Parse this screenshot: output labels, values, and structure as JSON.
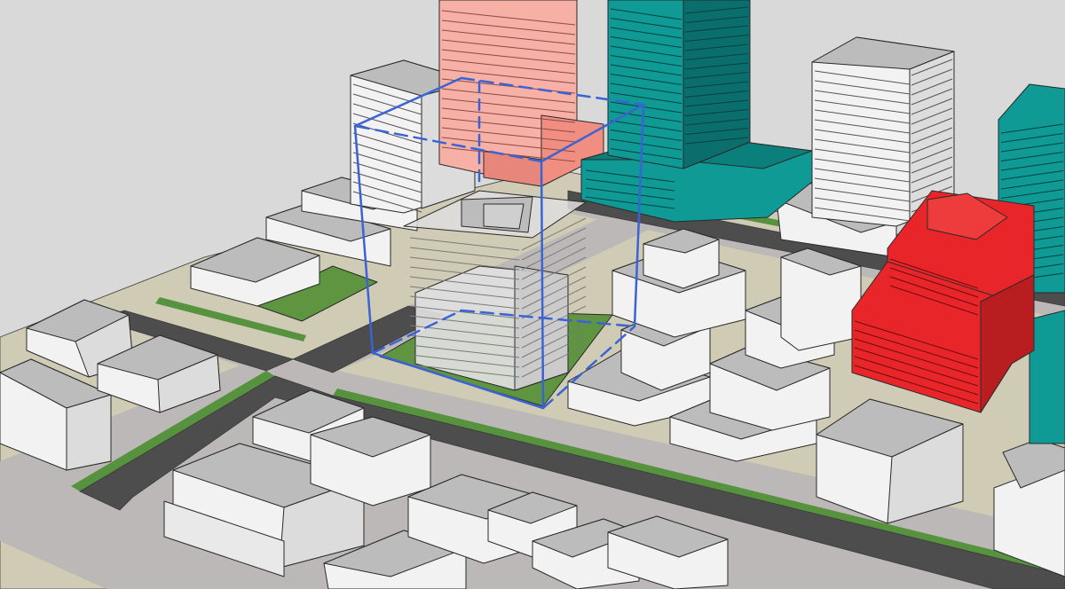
{
  "colors": {
    "background": "#d9d9d9",
    "ground": "#cfcbb4",
    "sidewalk": "#bdb8b8",
    "road": "#4d4d4d",
    "grass_strip": "#57933e",
    "lawn": "#5f9540",
    "massing_face_light": "#f2f2f2",
    "massing_face_mid": "#dcdcdc",
    "massing_roof": "#bcbcbc",
    "tower_teal": "#0f9a96",
    "tower_teal_dark": "#0a6f6c",
    "tower_salmon": "#f6b0a5",
    "tower_red": "#e8262a",
    "tower_red_dark": "#b81d1f",
    "envelope_outline": "#3a63d4",
    "proposed_building_glass": "#d6d6d6"
  },
  "scene": {
    "view": "axonometric",
    "subject": "proposed-building-massing",
    "highlighted": [
      "teal-towers",
      "salmon-tower",
      "red-building"
    ],
    "envelope_style": "dashed-blue-wireframe"
  }
}
